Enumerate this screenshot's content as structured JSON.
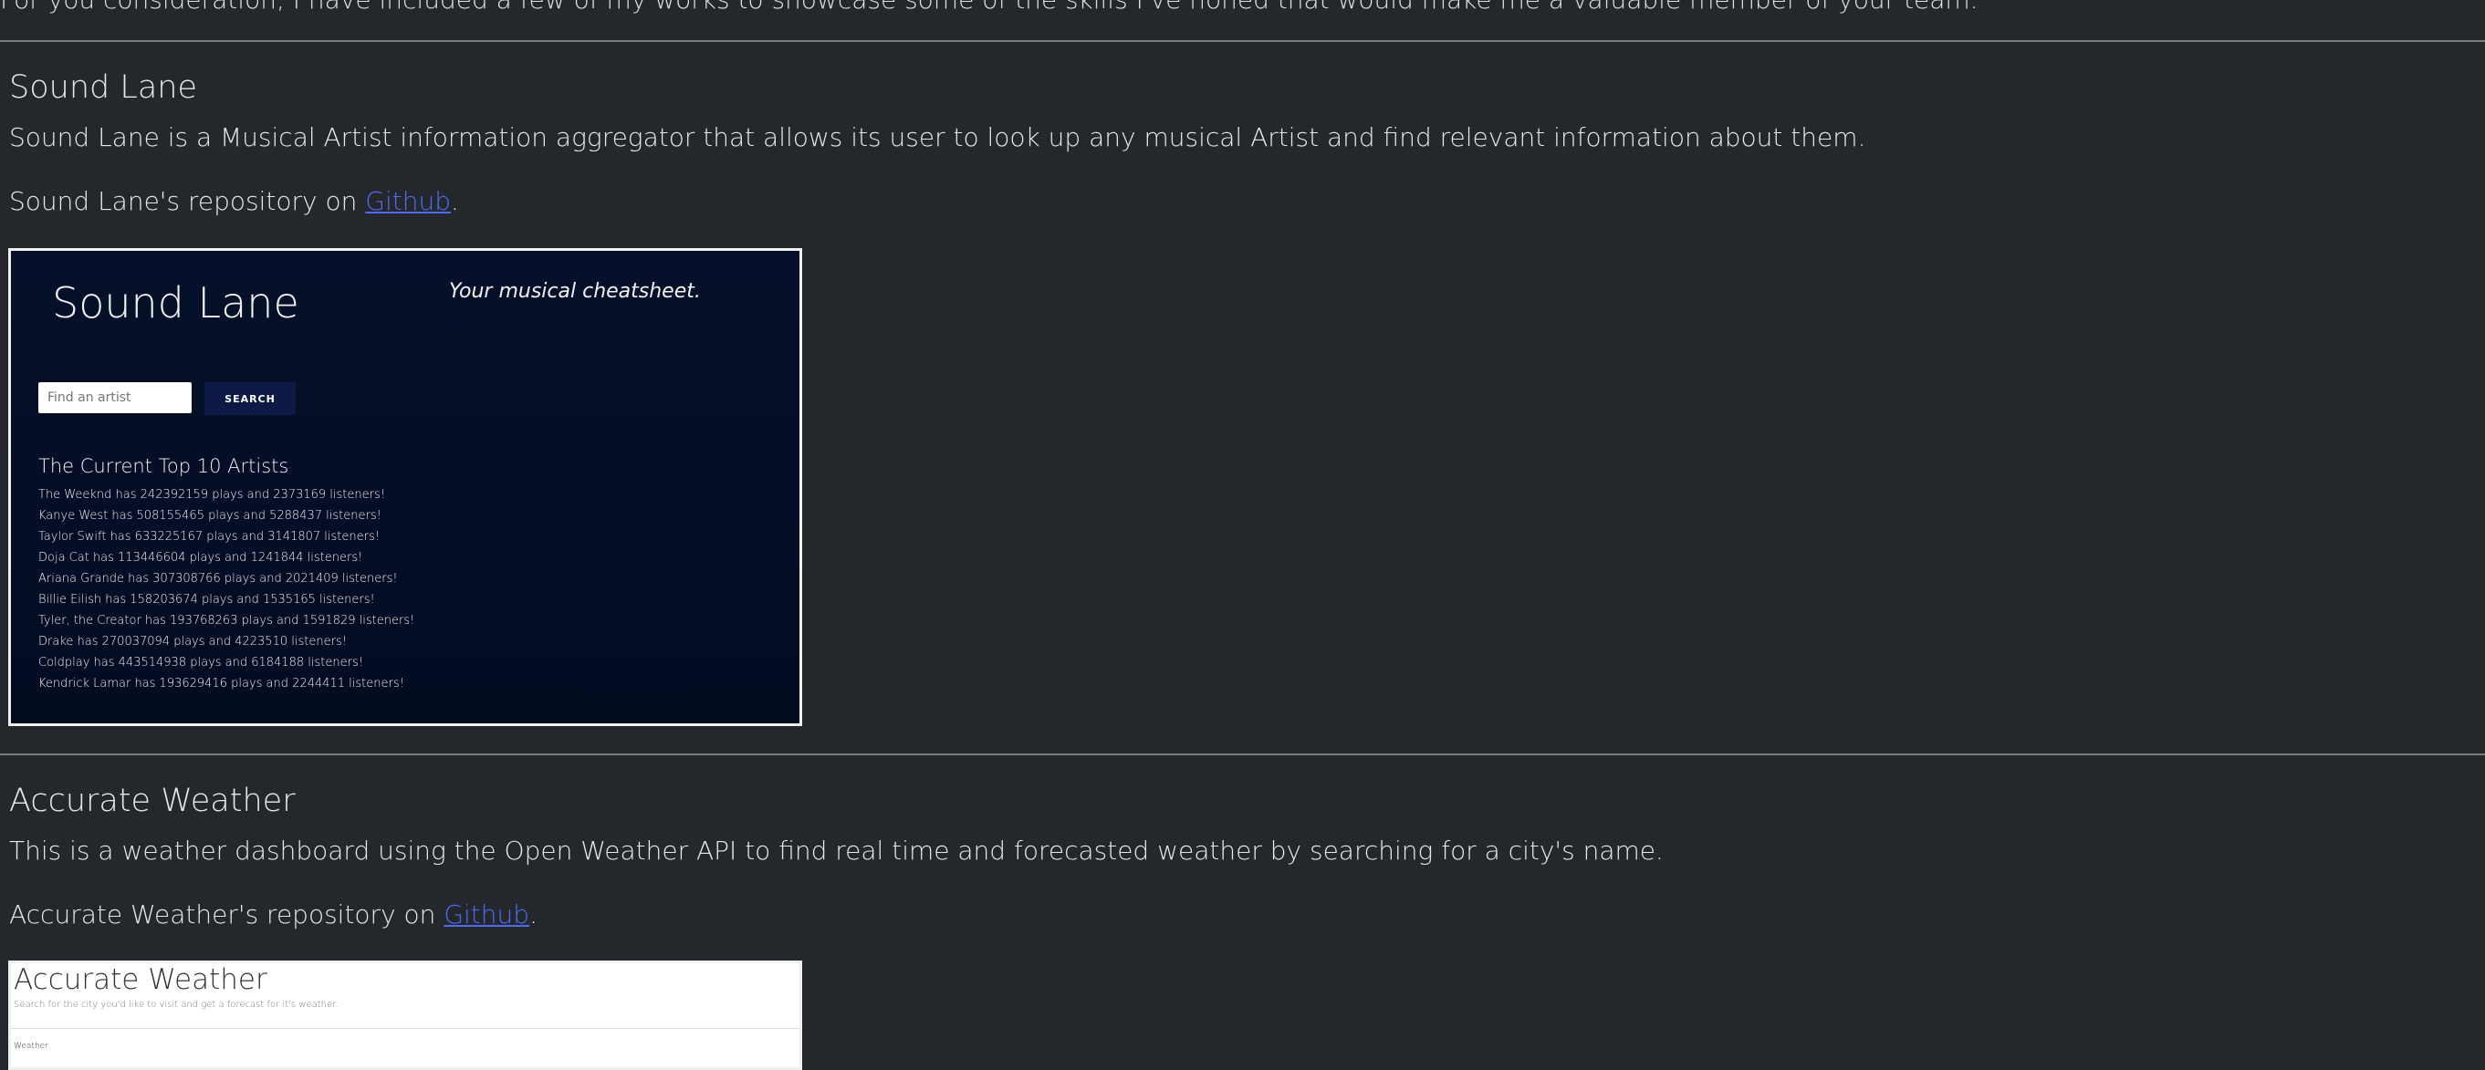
{
  "intro": "For you consideration, I have included a few of my works to showcase some of the skills I've honed that would make me a valuable member of your team.",
  "projects": [
    {
      "title": "Sound Lane",
      "description": "Sound Lane is a Musical Artist information aggregator that allows its user to look up any musical Artist and find relevant information about them.",
      "repo_prefix": "Sound Lane's repository on ",
      "repo_link": "Github",
      "repo_suffix": ".",
      "preview": {
        "title": "Sound Lane",
        "tagline": "Your musical cheatsheet.",
        "search_placeholder": "Find an artist",
        "search_button": "SEARCH",
        "list_heading": "The Current Top 10 Artists",
        "artists": [
          "The Weeknd has 242392159 plays and 2373169 listeners!",
          "Kanye West has 508155465 plays and 5288437 listeners!",
          "Taylor Swift has 633225167 plays and 3141807 listeners!",
          "Doja Cat has 113446604 plays and 1241844 listeners!",
          "Ariana Grande has 307308766 plays and 2021409 listeners!",
          "Billie Eilish has 158203674 plays and 1535165 listeners!",
          "Tyler, the Creator has 193768263 plays and 1591829 listeners!",
          "Drake has 270037094 plays and 4223510 listeners!",
          "Coldplay has 443514938 plays and 6184188 listeners!",
          "Kendrick Lamar has 193629416 plays and 2244411 listeners!"
        ]
      }
    },
    {
      "title": "Accurate Weather",
      "description": "This is a weather dashboard using the Open Weather API to find real time and forecasted weather by searching for a city's name.",
      "repo_prefix": "Accurate Weather's repository on ",
      "repo_link": "Github",
      "repo_suffix": ".",
      "preview": {
        "title": "Accurate Weather",
        "subtitle": "Search for the city you'd like to visit and get a forecast for it's weather.",
        "label": "Weather"
      }
    }
  ],
  "colors": {
    "background": "#24272b",
    "link": "#4f6cf2",
    "soundlane_bg": "#06102a"
  }
}
